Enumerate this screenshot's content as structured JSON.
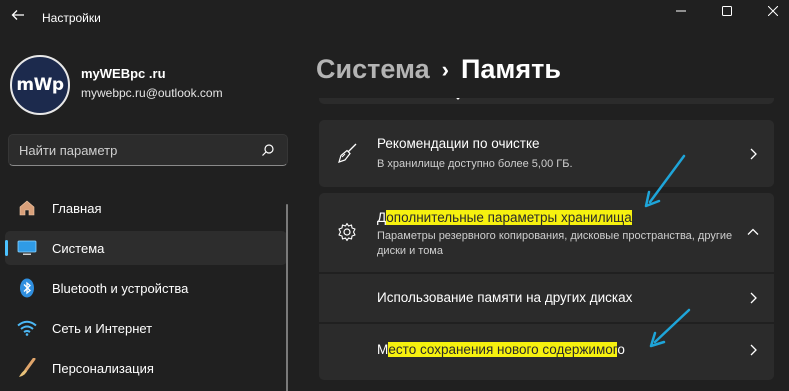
{
  "window": {
    "app_title": "Настройки",
    "back_icon": "back-arrow-icon"
  },
  "user": {
    "avatar_text": "mWp",
    "name": "myWEBpc .ru",
    "email": "mywebpc.ru@outlook.com"
  },
  "search": {
    "placeholder": "Найти параметр"
  },
  "nav": {
    "items": [
      {
        "label": "Главная",
        "icon": "home-icon"
      },
      {
        "label": "Система",
        "icon": "monitor-icon",
        "active": true
      },
      {
        "label": "Bluetooth и устройства",
        "icon": "bluetooth-icon"
      },
      {
        "label": "Сеть и Интернет",
        "icon": "wifi-icon"
      },
      {
        "label": "Персонализация",
        "icon": "brush-icon"
      }
    ]
  },
  "breadcrumb": {
    "parent": "Система",
    "separator": "›",
    "current": "Память"
  },
  "cards": {
    "cleanup": {
      "title": "Рекомендации по очистке",
      "subtitle": "В хранилище доступно более 5,00 ГБ."
    },
    "advanced": {
      "title_first": "Д",
      "title_highlight": "ополнительные параметры хранилища",
      "subtitle": "Параметры резервного копирования, дисковые пространства, другие диски и тома"
    },
    "other_disks": {
      "title": "Использование памяти на других дисках"
    },
    "save_location": {
      "title_first": "М",
      "title_highlight": "есто сохранения нового содержимог",
      "title_last": "о"
    }
  },
  "colors": {
    "accent": "#4cc2ff",
    "highlight": "#f6f10f",
    "annotation_arrow": "#1ea5d9",
    "background": "#202020",
    "card": "#2b2b2b"
  }
}
